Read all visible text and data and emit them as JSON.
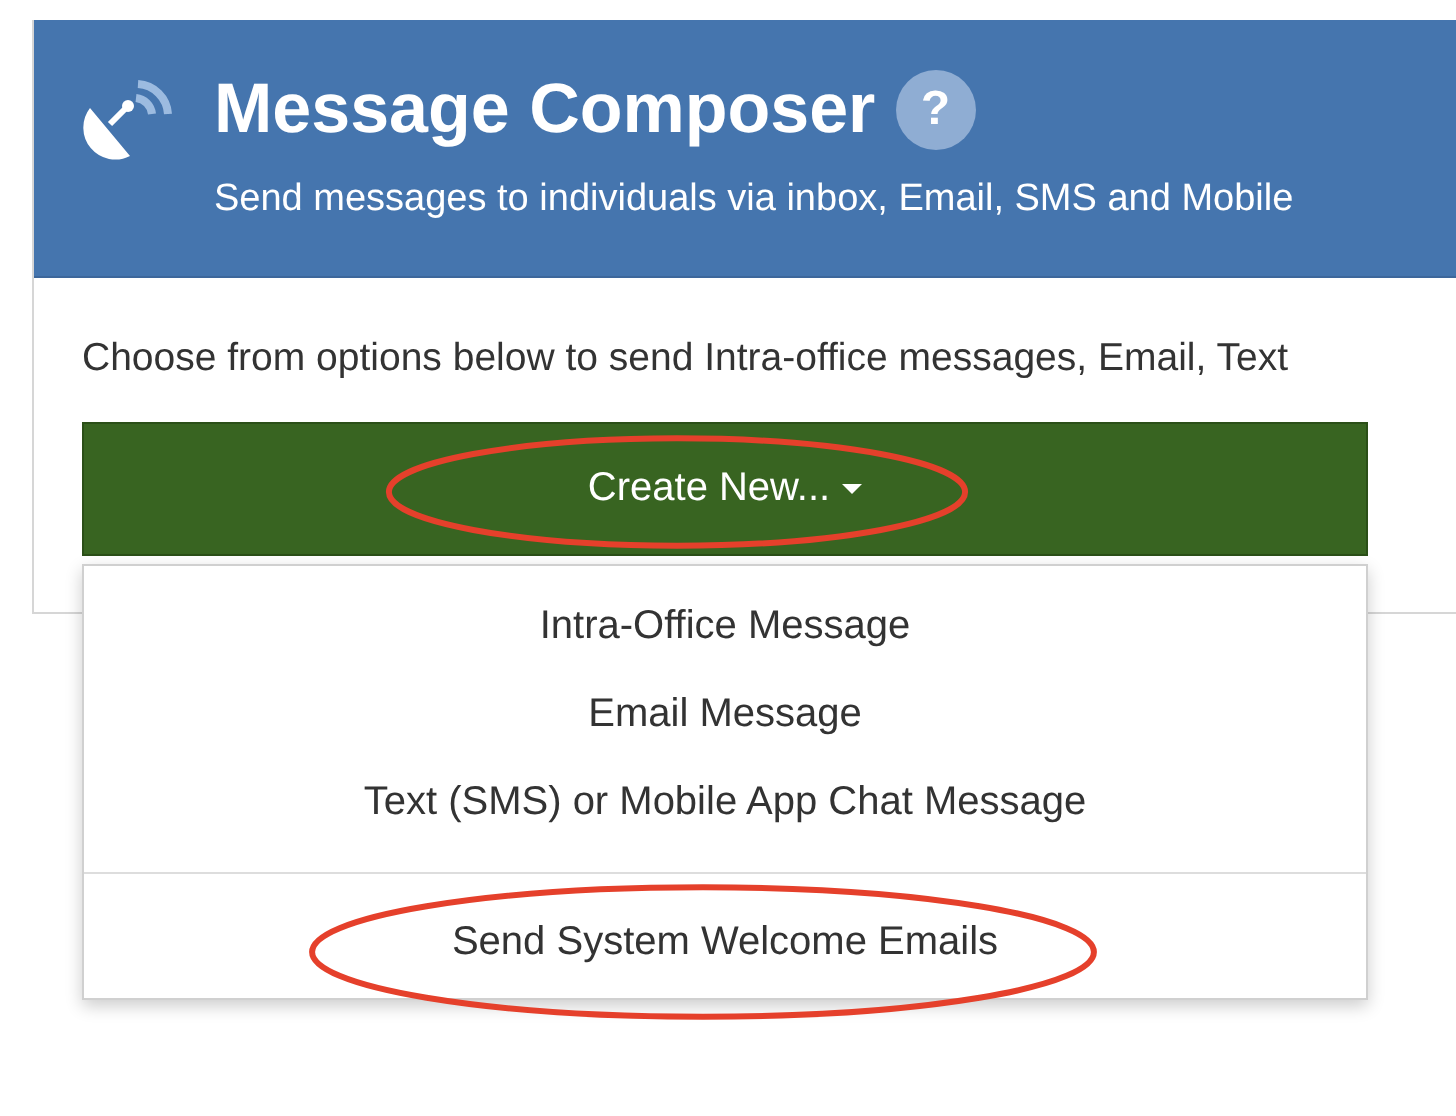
{
  "header": {
    "title": "Message Composer",
    "help": "?",
    "subtitle": "Send messages to individuals via inbox, Email, SMS and Mobile"
  },
  "intro": "Choose from options below to send Intra-office messages, Email, Text",
  "create_button": {
    "label": "Create New...",
    "expanded": true,
    "highlighted": true
  },
  "menu": {
    "groups": [
      [
        {
          "label": "Intra-Office Message",
          "highlighted": false
        },
        {
          "label": "Email Message",
          "highlighted": false
        },
        {
          "label": "Text (SMS) or Mobile App Chat Message",
          "highlighted": false
        }
      ],
      [
        {
          "label": "Send System Welcome Emails",
          "highlighted": true
        }
      ]
    ]
  }
}
